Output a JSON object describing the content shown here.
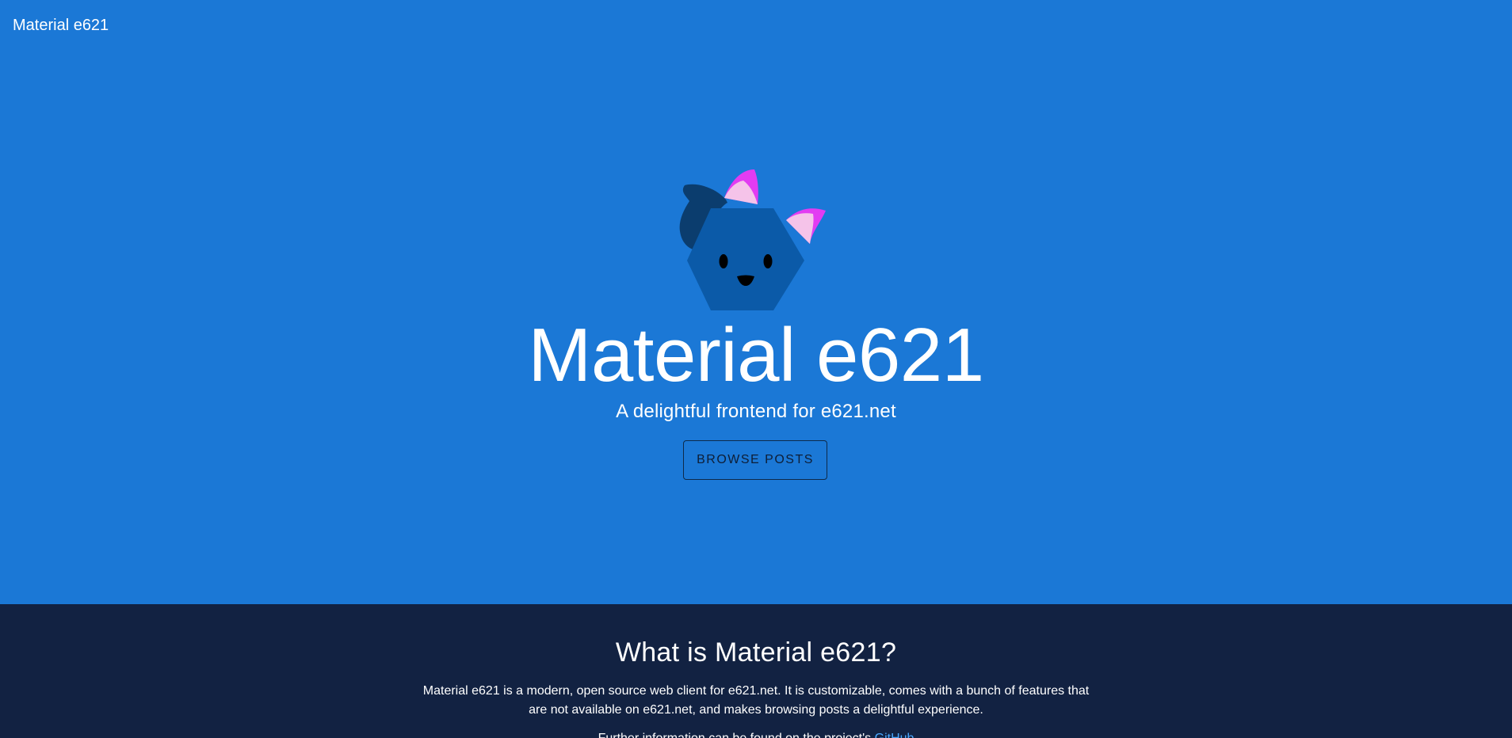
{
  "header": {
    "app_title": "Material e621"
  },
  "hero": {
    "title": "Material e621",
    "subtitle": "A delightful frontend for e621.net",
    "browse_button": "BROWSE POSTS",
    "mascot_icon": "hexagon-fox-mascot-icon"
  },
  "about": {
    "title": "What is Material e621?",
    "description": "Material e621 is a modern, open source web client for e621.net. It is customizable, comes with a bunch of features that are not available on e621.net, and makes browsing posts a delightful experience.",
    "more_prefix": "Further information can be found on the project's",
    "more_link": "GitHub"
  },
  "colors": {
    "hero_bg": "#1b78d6",
    "about_bg": "#122242",
    "mascot_body": "#0b5aa8",
    "mascot_tail": "#0b3d6e",
    "ear_pink": "#f5c3e9",
    "ear_magenta": "#e23cf2",
    "link": "#4aa8ff"
  }
}
